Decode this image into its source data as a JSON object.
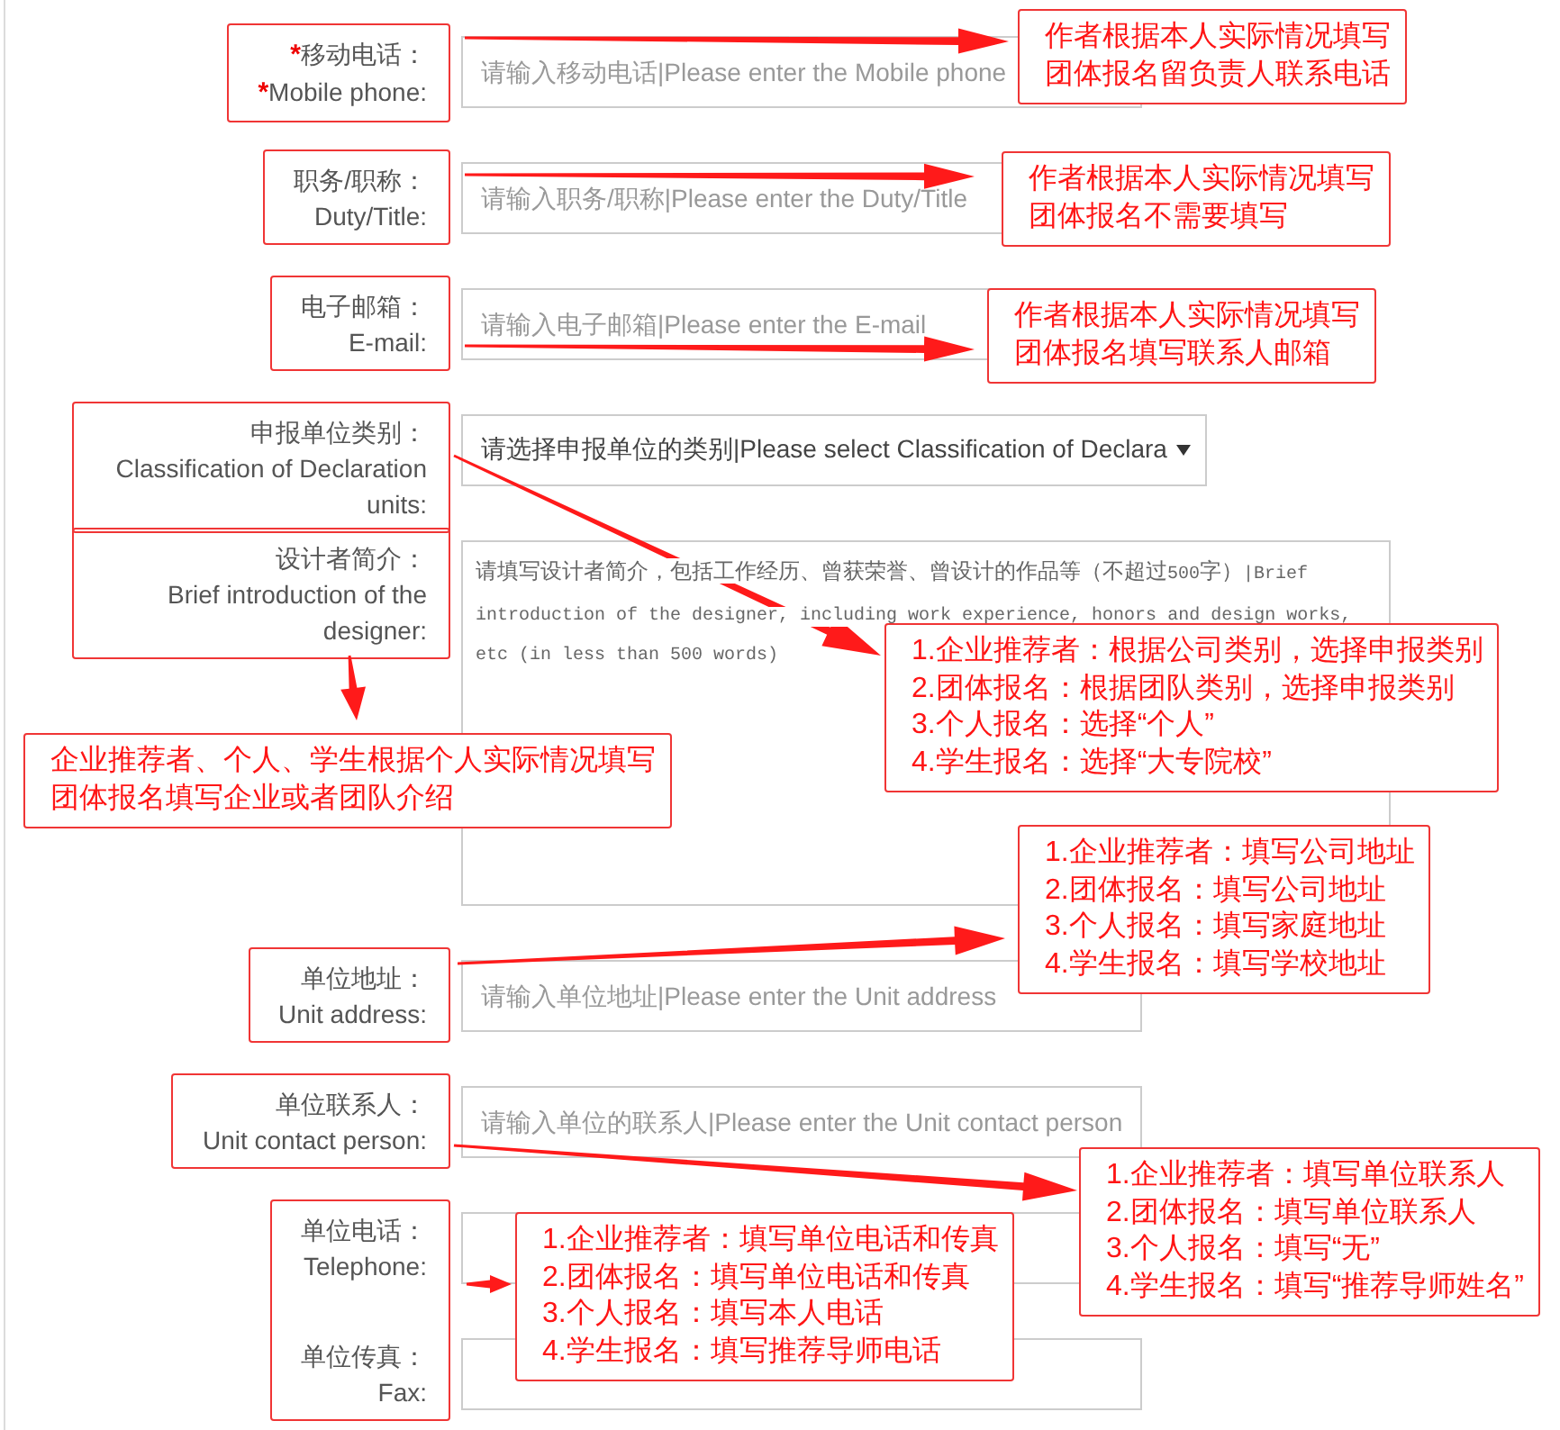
{
  "form": {
    "groups": [
      {
        "fields": [
          {
            "kind": "input",
            "label": [
              {
                "mark": "*",
                "text": "移动电话："
              },
              {
                "mark": "*",
                "text": "Mobile phone:"
              }
            ],
            "placeholder": "请输入移动电话|Please enter the Mobile phone"
          }
        ]
      },
      {
        "fields": [
          {
            "kind": "input",
            "label": [
              {
                "text": "职务/职称："
              },
              {
                "text": "Duty/Title:"
              }
            ],
            "placeholder": "请输入职务/职称|Please enter the Duty/Title"
          }
        ]
      },
      {
        "fields": [
          {
            "kind": "input",
            "label": [
              {
                "text": "电子邮箱："
              },
              {
                "text": "E-mail:"
              }
            ],
            "placeholder": "请输入电子邮箱|Please enter the E-mail"
          }
        ]
      },
      {
        "fields": [
          {
            "kind": "select",
            "label": [
              {
                "text": "申报单位类别："
              },
              {
                "text": "Classification of Declaration units:"
              }
            ],
            "value": "请选择申报单位的类别|Please select Classification of Declara"
          }
        ]
      },
      {
        "fields": [
          {
            "kind": "textarea",
            "label": [
              {
                "text": "设计者简介："
              },
              {
                "text": "Brief introduction of the designer:"
              }
            ],
            "placeholder": "请填写设计者简介，包括工作经历、曾获荣誉、曾设计的作品等（不超过500字）|Brief introduction of the designer, including work experience, honors and design works, etc (in less than 500 words)"
          }
        ]
      },
      {
        "fields": [
          {
            "kind": "input",
            "label": [
              {
                "text": "单位地址："
              },
              {
                "text": "Unit address:"
              }
            ],
            "placeholder": "请输入单位地址|Please enter the Unit address"
          }
        ]
      },
      {
        "fields": [
          {
            "kind": "input",
            "label": [
              {
                "text": "单位联系人："
              },
              {
                "text": "Unit contact person:"
              }
            ],
            "placeholder": "请输入单位的联系人|Please enter the Unit contact person"
          }
        ]
      },
      {
        "fields": [
          {
            "kind": "input",
            "label": [
              {
                "text": "单位电话："
              },
              {
                "text": "Telephone:"
              }
            ]
          },
          {
            "kind": "input",
            "label": [
              {
                "text": "单位传真："
              },
              {
                "text": "Fax:"
              }
            ]
          }
        ]
      }
    ]
  },
  "annotations": [
    {
      "lines": [
        "作者根据本人实际情况填写",
        "团体报名留负责人联系电话"
      ]
    },
    {
      "lines": [
        "作者根据本人实际情况填写",
        "团体报名不需要填写"
      ]
    },
    {
      "lines": [
        "作者根据本人实际情况填写",
        "团体报名填写联系人邮箱"
      ]
    },
    {
      "lines": [
        "1.企业推荐者：根据公司类别，选择申报类别",
        "2.团体报名：根据团队类别，选择申报类别",
        "3.个人报名：选择“个人”",
        "4.学生报名：选择“大专院校”"
      ]
    },
    {
      "lines": [
        "企业推荐者、个人、学生根据个人实际情况填写",
        "团体报名填写企业或者团队介绍"
      ]
    },
    {
      "lines": [
        "1.企业推荐者：填写公司地址",
        "2.团体报名：填写公司地址",
        "3.个人报名：填写家庭地址",
        "4.学生报名：填写学校地址"
      ]
    },
    {
      "lines": [
        "1.企业推荐者：填写单位联系人",
        "2.团体报名：填写单位联系人",
        "3.个人报名：填写“无”",
        "4.学生报名：填写“推荐导师姓名”"
      ]
    },
    {
      "lines": [
        "1.企业推荐者：填写单位电话和传真",
        "2.团体报名：填写单位电话和传真",
        "3.个人报名：填写本人电话",
        "4.学生报名：填写推荐导师电话"
      ]
    }
  ]
}
